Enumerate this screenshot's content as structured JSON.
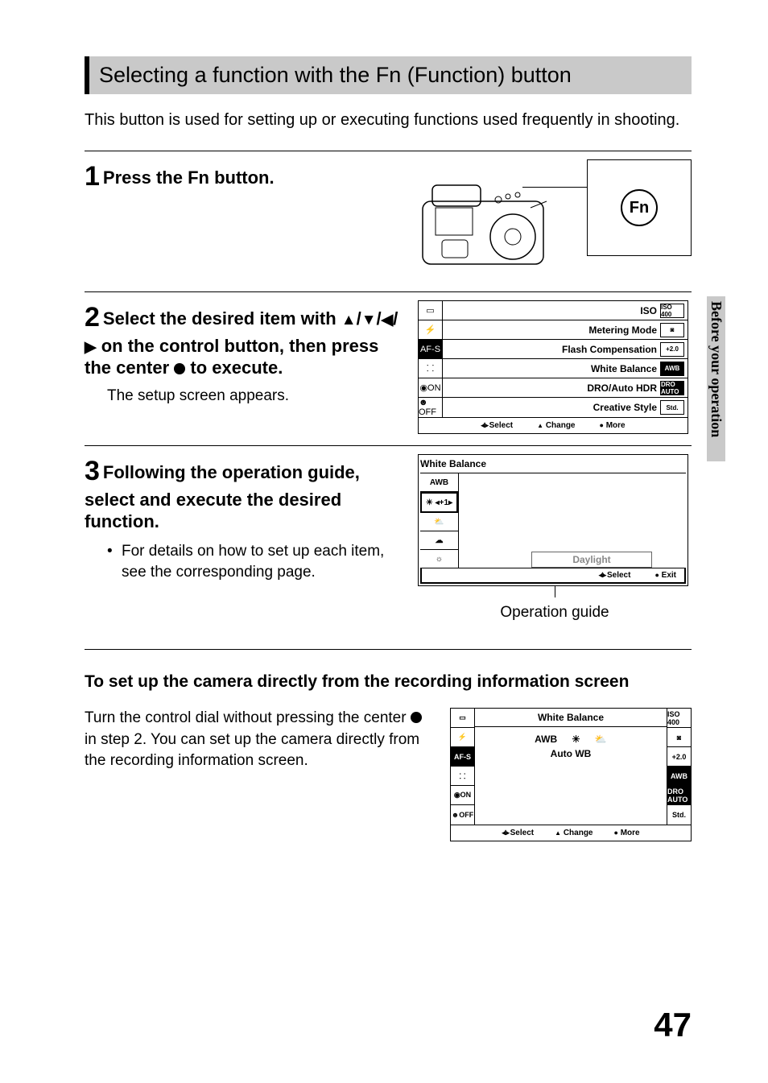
{
  "header": {
    "title": "Selecting a function with the Fn (Function) button"
  },
  "intro": "This button is used for setting up or executing functions used frequently in shooting.",
  "steps": [
    {
      "num": "1",
      "heading": "Press the Fn button.",
      "fn_label": "Fn"
    },
    {
      "num": "2",
      "heading_pre": "Select the desired item with ",
      "heading_mid": " on the control button, then press the center ",
      "heading_post": " to execute.",
      "body": "The setup screen appears.",
      "lcd": {
        "left_icons": [
          "▭",
          "⚡",
          "AF-S",
          "⸬",
          "◉ON",
          "☻OFF"
        ],
        "rows": [
          {
            "label": "ISO",
            "badge": "ISO 400",
            "inv": false
          },
          {
            "label": "Metering Mode",
            "badge": "◙",
            "inv": false
          },
          {
            "label": "Flash Compensation",
            "badge": "+2.0",
            "inv": false
          },
          {
            "label": "White Balance",
            "badge": "AWB",
            "inv": true
          },
          {
            "label": "DRO/Auto HDR",
            "badge": "DRO AUTO",
            "inv": true
          },
          {
            "label": "Creative Style",
            "badge": "Std.",
            "inv": false
          }
        ],
        "footer": [
          "Select",
          "Change",
          "More"
        ]
      }
    },
    {
      "num": "3",
      "heading": "Following the operation guide, select and execute the desired function.",
      "bullet": "For details on how to set up each item, see the corresponding page.",
      "lcd": {
        "title": "White Balance",
        "left": [
          "AWB",
          "☀ ◂+1▸",
          "⛅",
          "☁",
          "☼"
        ],
        "tooltip": "Daylight",
        "footer": [
          "Select",
          "Exit"
        ]
      },
      "op_guide": "Operation guide"
    }
  ],
  "subsection": {
    "heading": "To set up the camera directly from the recording information screen",
    "text_pre": "Turn the control dial without pressing the center ",
    "text_post": " in step 2. You can set up the camera directly from the recording information screen.",
    "lcd": {
      "left_icons": [
        "▭",
        "⚡",
        "AF-S",
        "⸬",
        "◉ON",
        "☻OFF"
      ],
      "right_icons": [
        "ISO 400",
        "◙",
        "+2.0",
        "AWB",
        "DRO AUTO",
        "Std."
      ],
      "right_inv": [
        false,
        false,
        false,
        true,
        true,
        false
      ],
      "center_title": "White Balance",
      "center_mid_left": "AWB",
      "center_mid_icons": [
        "☀",
        "⛅"
      ],
      "center_sub": "Auto WB",
      "footer": [
        "Select",
        "Change",
        "More"
      ]
    }
  },
  "side_tab": "Before your operation",
  "page_num": "47"
}
